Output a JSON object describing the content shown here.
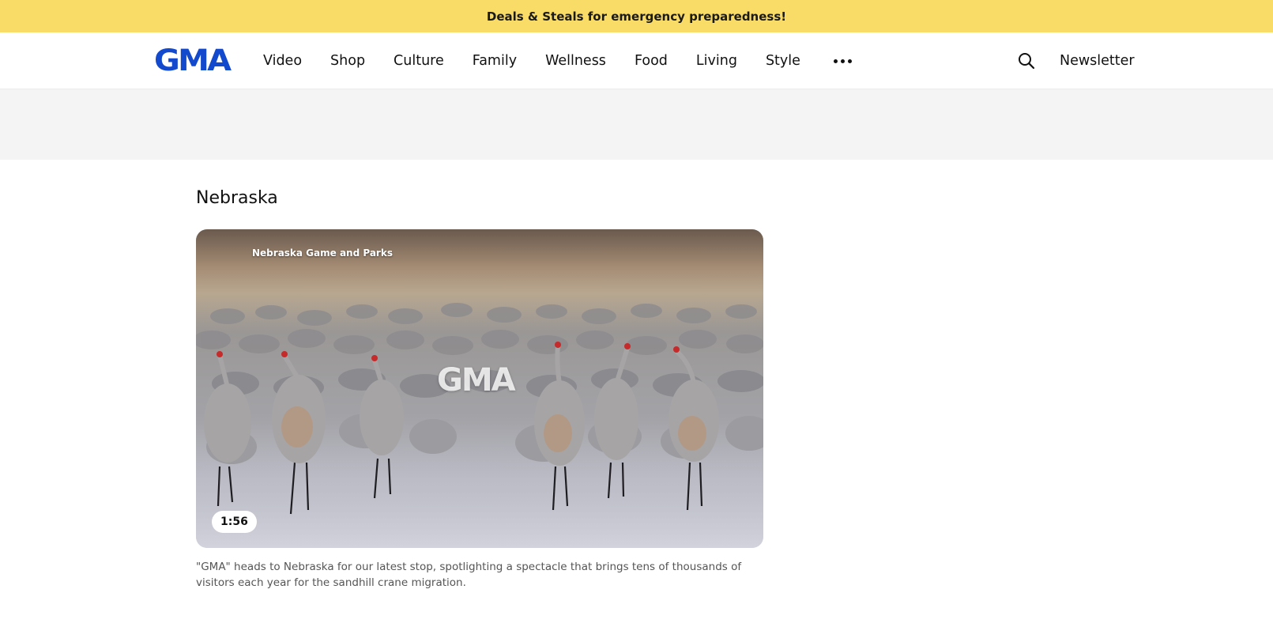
{
  "promo": {
    "text": "Deals & Steals for emergency preparedness!"
  },
  "header": {
    "logo": "GMA",
    "nav": [
      "Video",
      "Shop",
      "Culture",
      "Family",
      "Wellness",
      "Food",
      "Living",
      "Style"
    ],
    "more_icon": "ellipsis-icon",
    "search_icon": "search-icon",
    "newsletter": "Newsletter",
    "brand_color": "#1349cc"
  },
  "main": {
    "section_title": "Nebraska",
    "video": {
      "source_watermark": "Nebraska Game and Parks",
      "logo_watermark": "GMA",
      "duration": "1:56",
      "caption": "\"GMA\" heads to Nebraska for our latest stop, spotlighting a spectacle that brings tens of thousands of visitors each year for the sandhill crane migration."
    }
  },
  "colors": {
    "promo_bg": "#f9dc68",
    "ad_band_bg": "#f4f4f4"
  }
}
